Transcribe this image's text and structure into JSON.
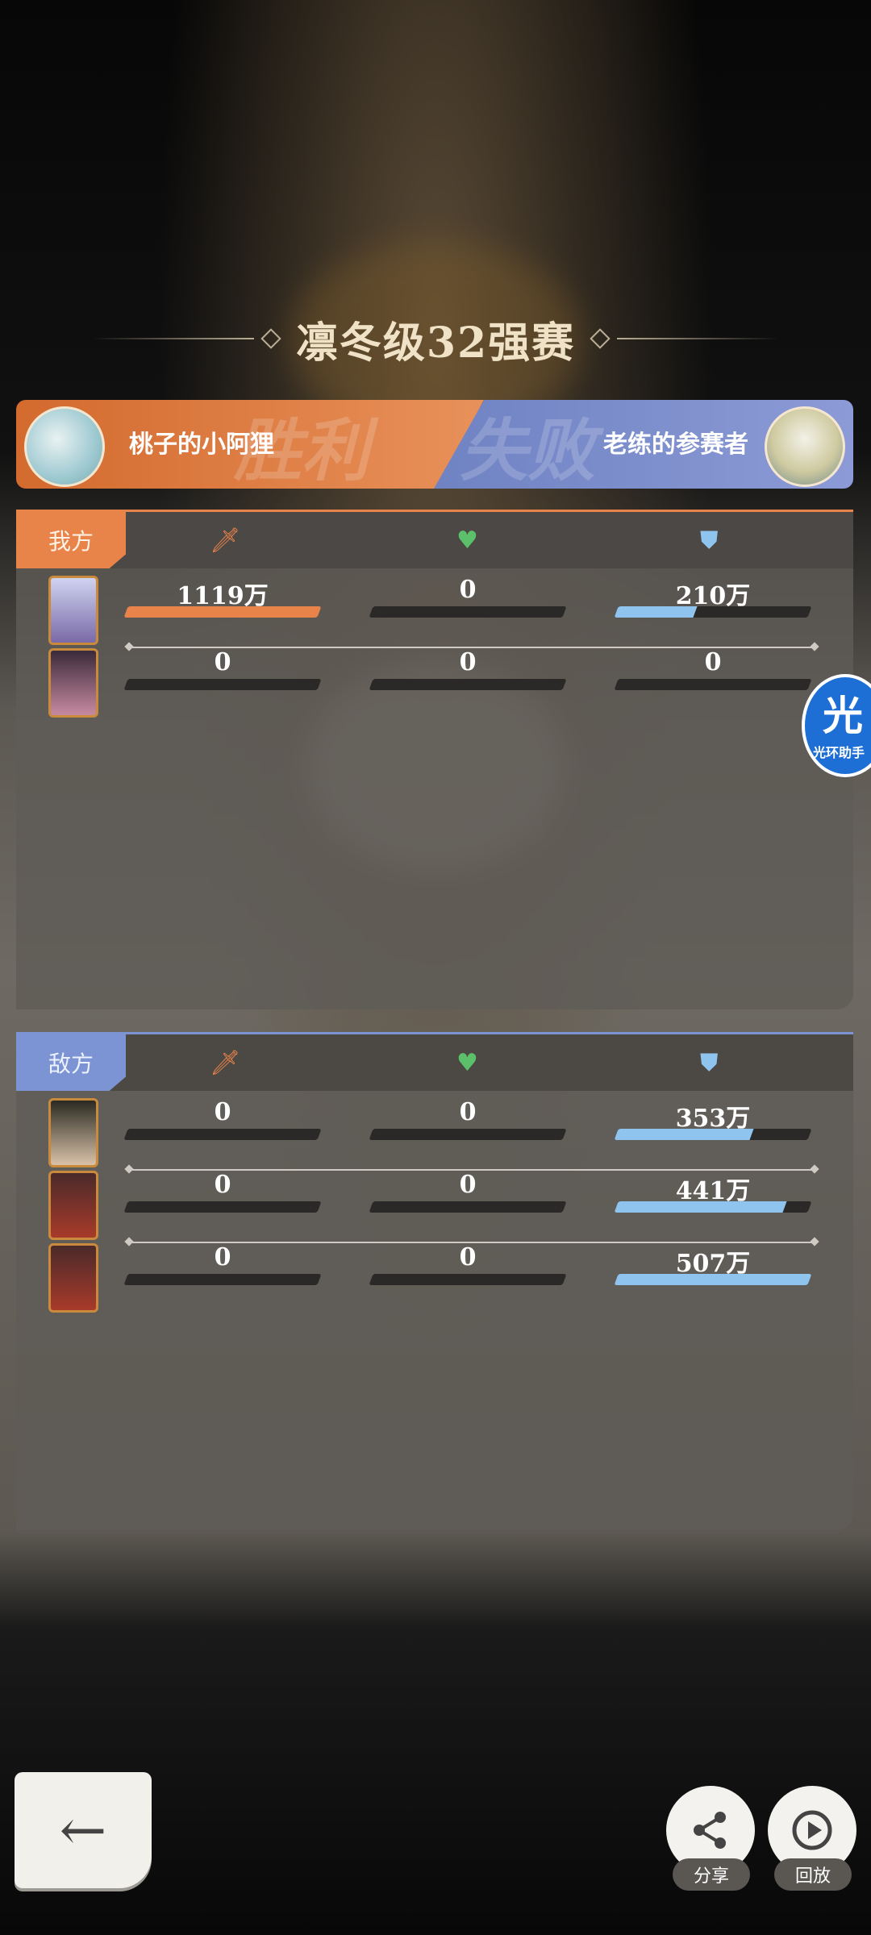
{
  "match": {
    "title": "凛冬级32强赛",
    "winner_word": "胜利",
    "loser_word": "失败",
    "left_player": "桃子的小阿狸",
    "right_player": "老练的参赛者"
  },
  "icons": {
    "attack": "sword-icon",
    "heal": "heart-icon",
    "defense": "shield-icon"
  },
  "colors": {
    "attack_bar": "#e8834a",
    "defense_bar": "#8fc4ef",
    "heal_icon": "#5cc06a",
    "ally_accent": "#e8834a",
    "enemy_accent": "#7c93d4"
  },
  "ally": {
    "label": "我方",
    "rows": [
      {
        "attack": "1119万",
        "heal": "0",
        "defense": "210万",
        "attack_fill": 1.0,
        "heal_fill": 0.0,
        "defense_fill": 0.41
      },
      {
        "attack": "0",
        "heal": "0",
        "defense": "0",
        "attack_fill": 0.0,
        "heal_fill": 0.0,
        "defense_fill": 0.0
      }
    ]
  },
  "enemy": {
    "label": "敌方",
    "rows": [
      {
        "attack": "0",
        "heal": "0",
        "defense": "353万",
        "attack_fill": 0.0,
        "heal_fill": 0.0,
        "defense_fill": 0.7
      },
      {
        "attack": "0",
        "heal": "0",
        "defense": "441万",
        "attack_fill": 0.0,
        "heal_fill": 0.0,
        "defense_fill": 0.87
      },
      {
        "attack": "0",
        "heal": "0",
        "defense": "507万",
        "attack_fill": 0.0,
        "heal_fill": 0.0,
        "defense_fill": 1.0
      }
    ]
  },
  "helper": {
    "glyph": "光",
    "label": "光环助手"
  },
  "controls": {
    "back_glyph": "←",
    "share_label": "分享",
    "replay_label": "回放"
  }
}
